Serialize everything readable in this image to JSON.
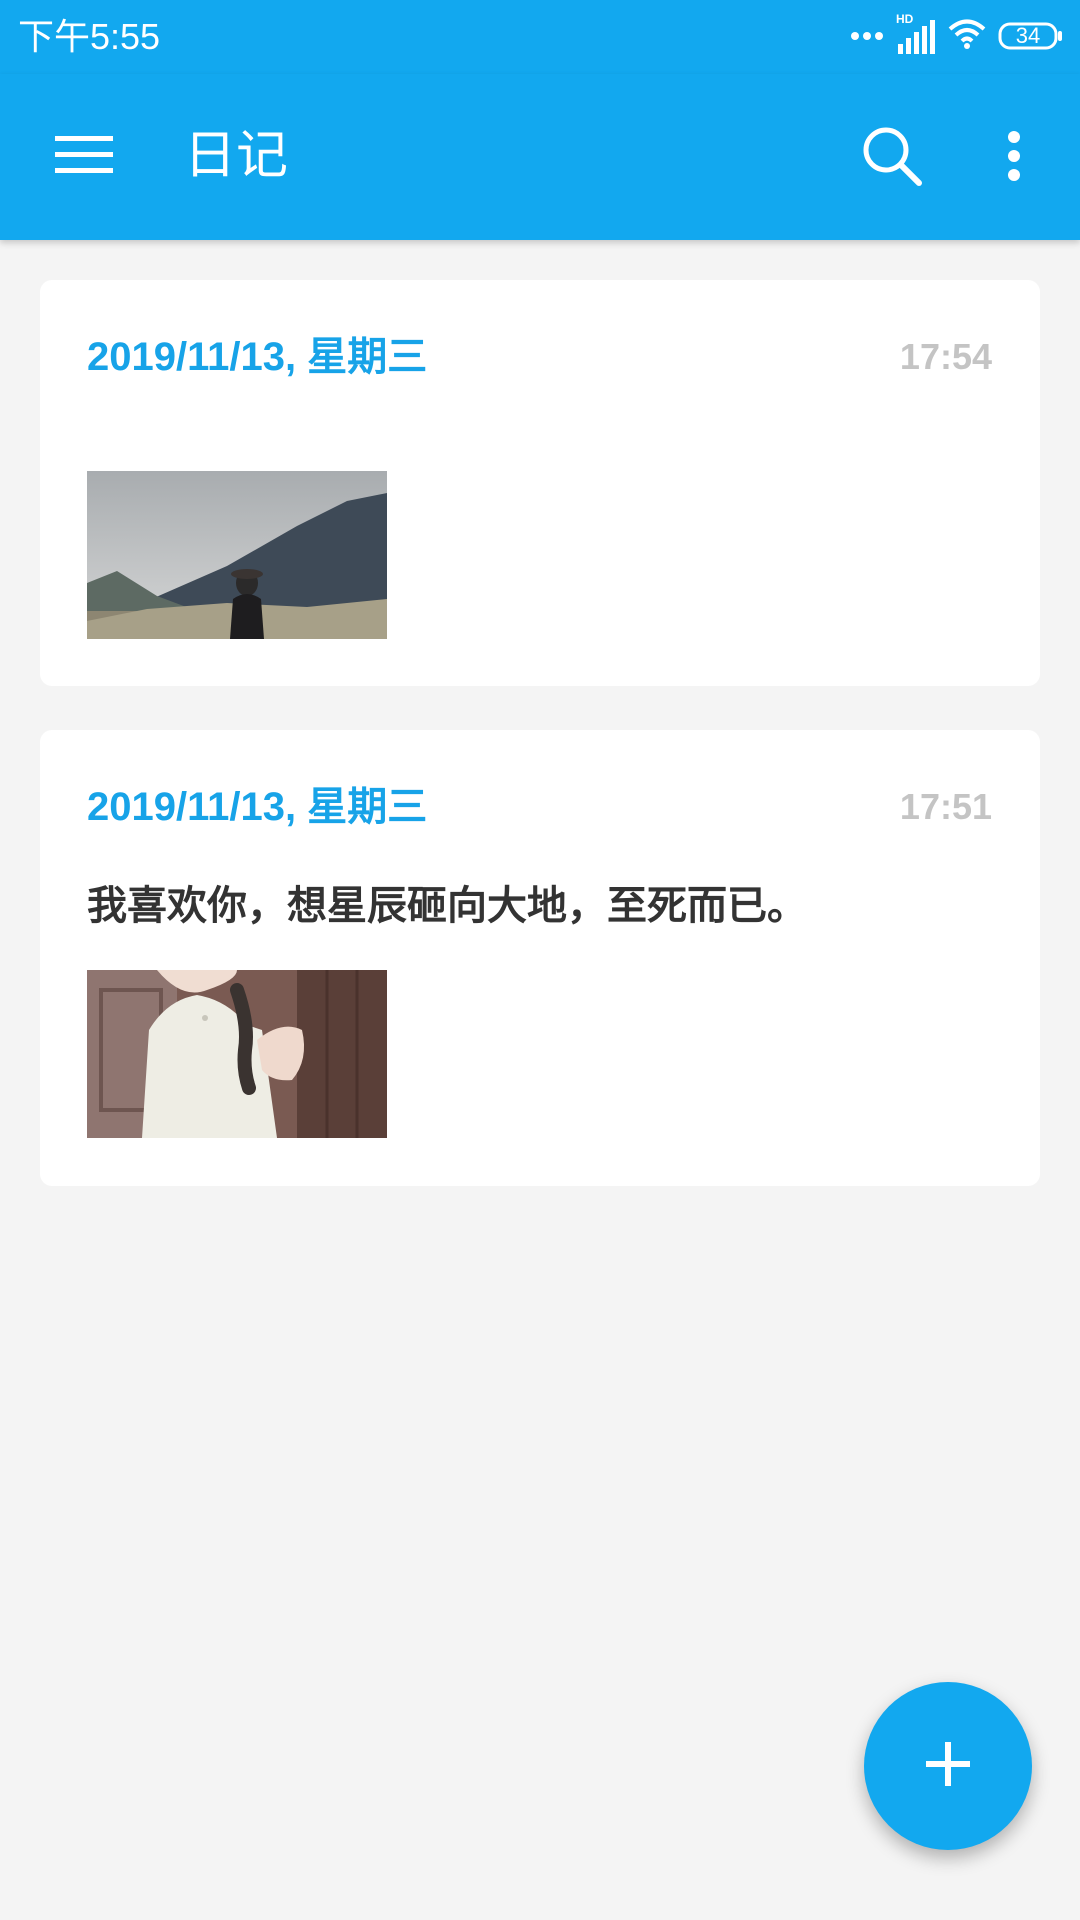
{
  "status_bar": {
    "time": "下午5:55",
    "network_label": "HD",
    "battery_level": "34"
  },
  "app_bar": {
    "title": "日记",
    "icons": [
      "menu-icon",
      "search-icon",
      "more-vert-icon"
    ]
  },
  "entries": [
    {
      "date": "2019/11/13, 星期三",
      "time": "17:54",
      "text": "",
      "image": "mountain-landscape-photo"
    },
    {
      "date": "2019/11/13, 星期三",
      "time": "17:51",
      "text": "我喜欢你，想星辰砸向大地，至死而已。",
      "image": "girl-white-dress-photo"
    }
  ],
  "fab": {
    "icon": "plus-icon"
  },
  "colors": {
    "primary": "#12a8ef",
    "date_accent": "#17a3e8",
    "time_gray": "#c4c4c4",
    "background": "#f4f4f4",
    "text": "#333333"
  }
}
